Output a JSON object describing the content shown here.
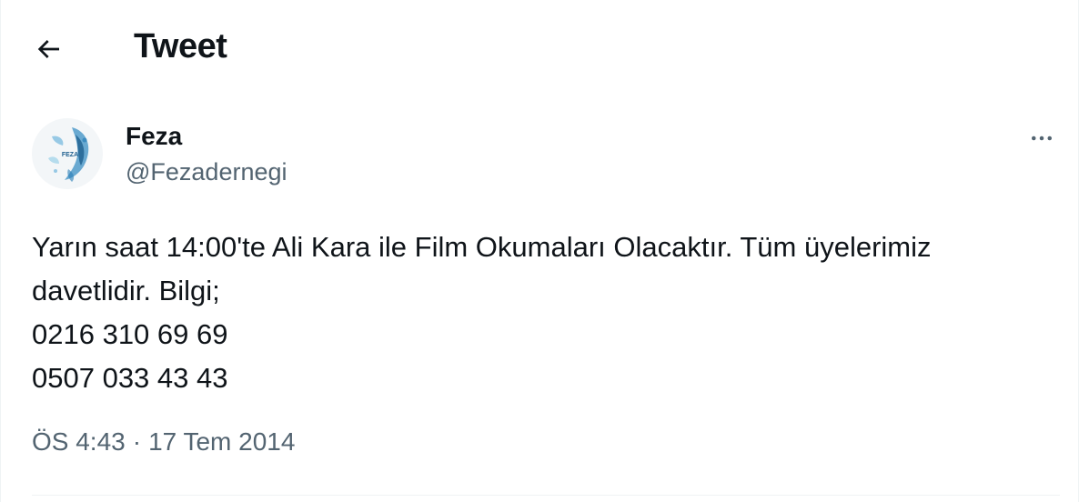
{
  "header": {
    "title": "Tweet",
    "back_icon": "arrow-left-icon"
  },
  "author": {
    "display_name": "Feza",
    "handle": "@Fezadernegi",
    "avatar_text": "FEZA"
  },
  "tweet": {
    "lines": [
      "Yarın saat 14:00'te Ali Kara ile Film Okumaları Olacaktır. Tüm üyelerimiz",
      "davetlidir. Bilgi;",
      "0216 310 69 69",
      "0507 033 43 43"
    ],
    "time": "ÖS 4:43",
    "separator": "·",
    "date": "17 Tem 2014"
  },
  "colors": {
    "text_primary": "#0f1419",
    "text_secondary": "#536471",
    "divider": "#eff3f4",
    "avatar_accent": "#2a7fb8"
  }
}
